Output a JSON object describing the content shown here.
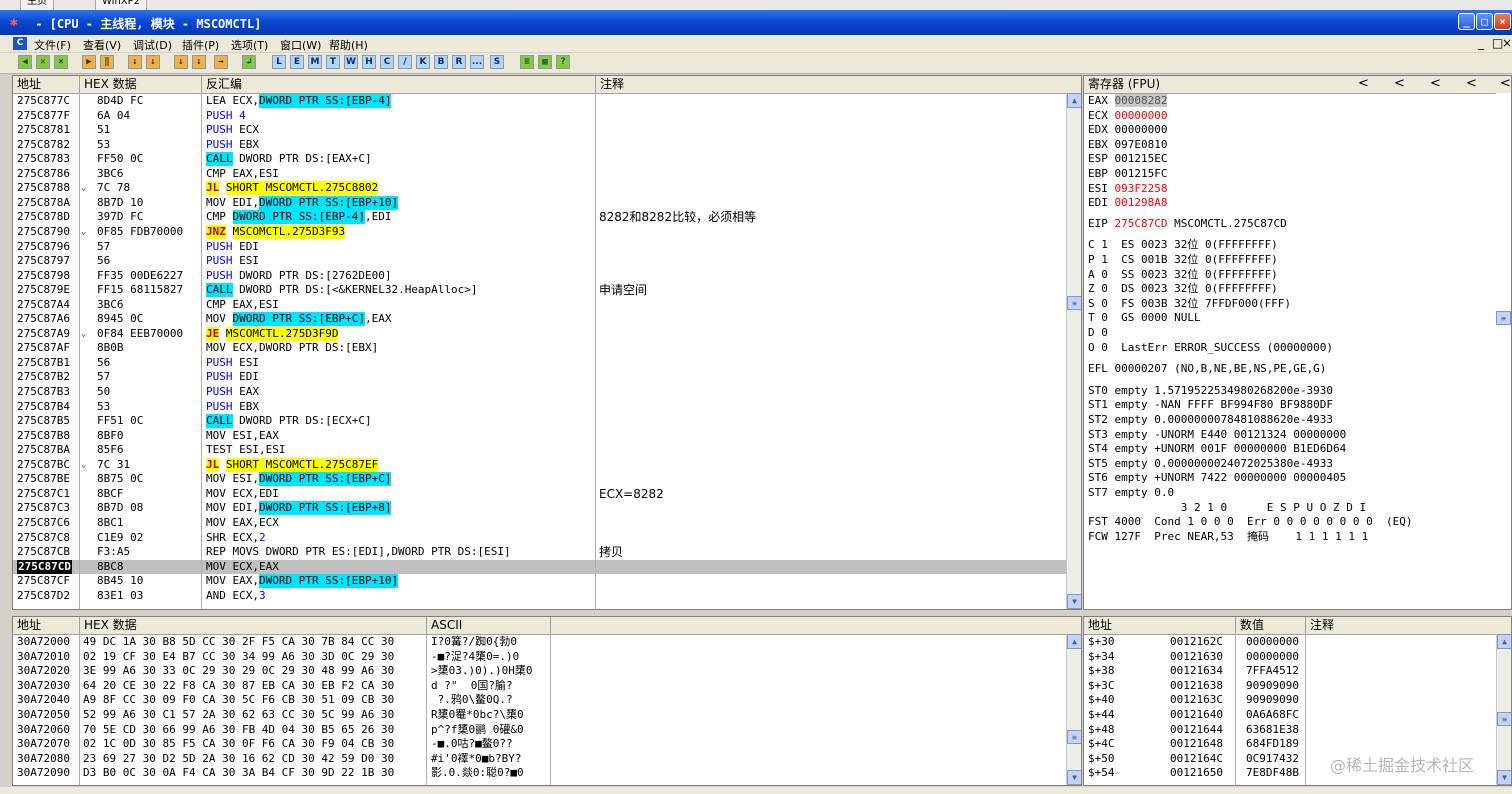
{
  "top_tabs": [
    "主页",
    "WinXP2"
  ],
  "window": {
    "title": " - [CPU - 主线程, 模块 - MSCOMCTL]",
    "btn_min": "_",
    "btn_max": "□",
    "btn_close": "×"
  },
  "menu": {
    "icon": "C",
    "items": [
      "文件(F)",
      "查看(V)",
      "调试(D)",
      "插件(P)",
      "选项(T)",
      "窗口(W)",
      "帮助(H)"
    ],
    "mdi": [
      "_",
      "□",
      "×"
    ]
  },
  "toolbar": {
    "buttons": [
      "◀",
      "✕",
      "×",
      "▶",
      "‖",
      "↓",
      "↓",
      "↓",
      "↓",
      "→",
      "↲"
    ],
    "letters": [
      "L",
      "E",
      "M",
      "T",
      "W",
      "H",
      "C",
      "/",
      "K",
      "B",
      "R",
      "...",
      "S"
    ],
    "tail": [
      "≡",
      "▦",
      "?"
    ]
  },
  "cpu": {
    "headers": [
      "地址",
      "HEX 数据",
      "反汇编",
      "注释"
    ],
    "rows": [
      {
        "addr": "275C877C",
        "mark": "",
        "hex": "8D4D FC",
        "mn": "LEA",
        "ops": [
          {
            "t": "ECX,"
          },
          {
            "t": "DWORD PTR SS:[EBP-4]",
            "c": "memop"
          }
        ],
        "com": "",
        "sel": false
      },
      {
        "addr": "275C877F",
        "mark": "",
        "hex": "6A 04",
        "mn": "PUSH",
        "mncls": "blue",
        "ops": [
          {
            "t": "4",
            "c": "blue"
          }
        ],
        "com": "",
        "sel": false
      },
      {
        "addr": "275C8781",
        "mark": "",
        "hex": "51",
        "mn": "PUSH",
        "mncls": "blue",
        "ops": [
          {
            "t": "ECX"
          }
        ],
        "com": "",
        "sel": false
      },
      {
        "addr": "275C8782",
        "mark": "",
        "hex": "53",
        "mn": "PUSH",
        "mncls": "blue",
        "ops": [
          {
            "t": "EBX"
          }
        ],
        "com": "",
        "sel": false
      },
      {
        "addr": "275C8783",
        "mark": "",
        "hex": "FF50 0C",
        "mn": "CALL",
        "mncls": "callbg",
        "ops": [
          {
            "t": "DWORD PTR DS:[EAX+C]"
          }
        ],
        "com": "",
        "sel": false
      },
      {
        "addr": "275C8786",
        "mark": "",
        "hex": "3BC6",
        "mn": "CMP",
        "ops": [
          {
            "t": "EAX,ESI"
          }
        ],
        "com": "",
        "sel": false
      },
      {
        "addr": "275C8788",
        "mark": "⌄",
        "hex": "7C 78",
        "mn": "JL",
        "mncls": "jmpbg",
        "ops": [
          {
            "t": "SHORT MSCOMCTL.275C8802",
            "c": "jtarget"
          }
        ],
        "com": "",
        "sel": false
      },
      {
        "addr": "275C878A",
        "mark": "",
        "hex": "8B7D 10",
        "mn": "MOV",
        "ops": [
          {
            "t": "EDI,"
          },
          {
            "t": "DWORD PTR SS:[EBP+10]",
            "c": "memop"
          }
        ],
        "com": "",
        "sel": false
      },
      {
        "addr": "275C878D",
        "mark": "",
        "hex": "397D FC",
        "mn": "CMP",
        "ops": [
          {
            "t": "DWORD PTR SS:[EBP-4]",
            "c": "memop"
          },
          {
            "t": ",EDI"
          }
        ],
        "com": "8282和8282比较，必须相等",
        "sel": false
      },
      {
        "addr": "275C8790",
        "mark": "⌄",
        "hex": "0F85 FDB70000",
        "mn": "JNZ",
        "mncls": "jmpbg",
        "ops": [
          {
            "t": "MSCOMCTL.275D3F93",
            "c": "jtarget"
          }
        ],
        "com": "",
        "sel": false
      },
      {
        "addr": "275C8796",
        "mark": "",
        "hex": "57",
        "mn": "PUSH",
        "mncls": "blue",
        "ops": [
          {
            "t": "EDI"
          }
        ],
        "com": "",
        "sel": false
      },
      {
        "addr": "275C8797",
        "mark": "",
        "hex": "56",
        "mn": "PUSH",
        "mncls": "blue",
        "ops": [
          {
            "t": "ESI"
          }
        ],
        "com": "",
        "sel": false
      },
      {
        "addr": "275C8798",
        "mark": "",
        "hex": "FF35 00DE6227",
        "mn": "PUSH",
        "mncls": "blue",
        "ops": [
          {
            "t": "DWORD PTR DS:[2762DE00]"
          }
        ],
        "com": "",
        "sel": false
      },
      {
        "addr": "275C879E",
        "mark": "",
        "hex": "FF15 68115827",
        "mn": "CALL",
        "mncls": "callbg",
        "ops": [
          {
            "t": "DWORD PTR DS:[<&KERNEL32.HeapAlloc>]"
          }
        ],
        "com": "申请空间",
        "sel": false
      },
      {
        "addr": "275C87A4",
        "mark": "",
        "hex": "3BC6",
        "mn": "CMP",
        "ops": [
          {
            "t": "EAX,ESI"
          }
        ],
        "com": "",
        "sel": false
      },
      {
        "addr": "275C87A6",
        "mark": "",
        "hex": "8945 0C",
        "mn": "MOV",
        "ops": [
          {
            "t": "DWORD PTR SS:[EBP+C]",
            "c": "memop"
          },
          {
            "t": ",EAX"
          }
        ],
        "com": "",
        "sel": false
      },
      {
        "addr": "275C87A9",
        "mark": "⌄",
        "hex": "0F84 EEB70000",
        "mn": "JE",
        "mncls": "jmpbg",
        "ops": [
          {
            "t": "MSCOMCTL.275D3F9D",
            "c": "jtarget"
          }
        ],
        "com": "",
        "sel": false
      },
      {
        "addr": "275C87AF",
        "mark": "",
        "hex": "8B0B",
        "mn": "MOV",
        "ops": [
          {
            "t": "ECX,DWORD PTR DS:[EBX]"
          }
        ],
        "com": "",
        "sel": false
      },
      {
        "addr": "275C87B1",
        "mark": "",
        "hex": "56",
        "mn": "PUSH",
        "mncls": "blue",
        "ops": [
          {
            "t": "ESI"
          }
        ],
        "com": "",
        "sel": false
      },
      {
        "addr": "275C87B2",
        "mark": "",
        "hex": "57",
        "mn": "PUSH",
        "mncls": "blue",
        "ops": [
          {
            "t": "EDI"
          }
        ],
        "com": "",
        "sel": false
      },
      {
        "addr": "275C87B3",
        "mark": "",
        "hex": "50",
        "mn": "PUSH",
        "mncls": "blue",
        "ops": [
          {
            "t": "EAX"
          }
        ],
        "com": "",
        "sel": false
      },
      {
        "addr": "275C87B4",
        "mark": "",
        "hex": "53",
        "mn": "PUSH",
        "mncls": "blue",
        "ops": [
          {
            "t": "EBX"
          }
        ],
        "com": "",
        "sel": false
      },
      {
        "addr": "275C87B5",
        "mark": "",
        "hex": "FF51 0C",
        "mn": "CALL",
        "mncls": "callbg",
        "ops": [
          {
            "t": "DWORD PTR DS:[ECX+C]"
          }
        ],
        "com": "",
        "sel": false
      },
      {
        "addr": "275C87B8",
        "mark": "",
        "hex": "8BF0",
        "mn": "MOV",
        "ops": [
          {
            "t": "ESI,EAX"
          }
        ],
        "com": "",
        "sel": false
      },
      {
        "addr": "275C87BA",
        "mark": "",
        "hex": "85F6",
        "mn": "TEST",
        "ops": [
          {
            "t": "ESI,ESI"
          }
        ],
        "com": "",
        "sel": false
      },
      {
        "addr": "275C87BC",
        "mark": "⌄",
        "hex": "7C 31",
        "mn": "JL",
        "mncls": "jmpbg",
        "ops": [
          {
            "t": "SHORT MSCOMCTL.275C87EF",
            "c": "jtarget"
          }
        ],
        "com": "",
        "sel": false
      },
      {
        "addr": "275C87BE",
        "mark": "",
        "hex": "8B75 0C",
        "mn": "MOV",
        "ops": [
          {
            "t": "ESI,"
          },
          {
            "t": "DWORD PTR SS:[EBP+C]",
            "c": "memop"
          }
        ],
        "com": "",
        "sel": false
      },
      {
        "addr": "275C87C1",
        "mark": "",
        "hex": "8BCF",
        "mn": "MOV",
        "ops": [
          {
            "t": "ECX,EDI"
          }
        ],
        "com": "ECX=8282",
        "sel": false
      },
      {
        "addr": "275C87C3",
        "mark": "",
        "hex": "8B7D 08",
        "mn": "MOV",
        "ops": [
          {
            "t": "EDI,"
          },
          {
            "t": "DWORD PTR SS:[EBP+8]",
            "c": "memop"
          }
        ],
        "com": "",
        "sel": false
      },
      {
        "addr": "275C87C6",
        "mark": "",
        "hex": "8BC1",
        "mn": "MOV",
        "ops": [
          {
            "t": "EAX,ECX"
          }
        ],
        "com": "",
        "sel": false
      },
      {
        "addr": "275C87C8",
        "mark": "",
        "hex": "C1E9 02",
        "mn": "SHR",
        "ops": [
          {
            "t": "ECX,"
          },
          {
            "t": "2",
            "c": "blue"
          }
        ],
        "com": "",
        "sel": false
      },
      {
        "addr": "275C87CB",
        "mark": "",
        "hex": "F3:A5",
        "mn": "REP MOVS",
        "ops": [
          {
            "t": "DWORD PTR ES:[EDI],DWORD PTR DS:[ESI]"
          }
        ],
        "com": "拷贝",
        "sel": false
      },
      {
        "addr": "275C87CD",
        "mark": "",
        "hex": "8BC8",
        "mn": "MOV",
        "ops": [
          {
            "t": "ECX,EAX"
          }
        ],
        "com": "",
        "sel": true
      },
      {
        "addr": "275C87CF",
        "mark": "",
        "hex": "8B45 10",
        "mn": "MOV",
        "ops": [
          {
            "t": "EAX,"
          },
          {
            "t": "DWORD PTR SS:[EBP+10]",
            "c": "memop"
          }
        ],
        "com": "",
        "sel": false
      },
      {
        "addr": "275C87D2",
        "mark": "",
        "hex": "83E1 03",
        "mn": "AND",
        "ops": [
          {
            "t": "ECX,"
          },
          {
            "t": "3",
            "c": "blue"
          }
        ],
        "com": "",
        "sel": false
      }
    ]
  },
  "registers": {
    "title": "寄存器 (FPU)",
    "nav": [
      "<",
      "<",
      "<",
      "<",
      "<"
    ],
    "gp": [
      {
        "name": "EAX",
        "val": "00008282",
        "style": "grayhl",
        "extra": ""
      },
      {
        "name": "ECX",
        "val": "00000000",
        "style": "red",
        "extra": ""
      },
      {
        "name": "EDX",
        "val": "00000000",
        "style": "",
        "extra": ""
      },
      {
        "name": "EBX",
        "val": "097E0810",
        "style": "",
        "extra": ""
      },
      {
        "name": "ESP",
        "val": "001215EC",
        "style": "",
        "extra": ""
      },
      {
        "name": "EBP",
        "val": "001215FC",
        "style": "",
        "extra": ""
      },
      {
        "name": "ESI",
        "val": "093F2258",
        "style": "red",
        "extra": ""
      },
      {
        "name": "EDI",
        "val": "001298A8",
        "style": "red",
        "extra": ""
      }
    ],
    "eip": {
      "name": "EIP",
      "val": "275C87CD",
      "extra": "MSCOMCTL.275C87CD"
    },
    "seg": [
      "C 1  ES 0023 32位 0(FFFFFFFF)",
      "P 1  CS 001B 32位 0(FFFFFFFF)",
      "A 0  SS 0023 32位 0(FFFFFFFF)",
      "Z 0  DS 0023 32位 0(FFFFFFFF)",
      "S 0  FS 003B 32位 7FFDF000(FFF)",
      "T 0  GS 0000 NULL",
      "D 0",
      "O 0  LastErr ERROR_SUCCESS (00000000)"
    ],
    "efl": "EFL 00000207 (NO,B,NE,BE,NS,PE,GE,G)",
    "st": [
      "ST0 empty 1.5719522534980268200e-3930",
      "ST1 empty -NAN FFFF BF994F80 BF9880DF",
      "ST2 empty 0.0000000078481088620e-4933",
      "ST3 empty -UNORM E440 00121324 00000000",
      "ST4 empty +UNORM 001F 00000000 B1ED6D64",
      "ST5 empty 0.0000000024072025380e-4933",
      "ST6 empty +UNORM 7422 00000000 00000405",
      "ST7 empty 0.0"
    ],
    "fpu_hdr": "              3 2 1 0      E S P U O Z D I",
    "fst": "FST 4000  Cond 1 0 0 0  Err 0 0 0 0 0 0 0 0  (EQ)",
    "fcw": "FCW 127F  Prec NEAR,53  掩码    1 1 1 1 1 1"
  },
  "dump": {
    "headers": [
      "地址",
      "HEX 数据",
      "ASCII"
    ],
    "rows": [
      {
        "addr": "30A72000",
        "hex": "49 DC 1A 30 B8 5D CC 30 2F F5 CA 30 7B 84 CC 30",
        "ascii": "I?0篝?/踟0{勃0"
      },
      {
        "addr": "30A72010",
        "hex": "02 19 CF 30 E4 B7 CC 30 34 99 A6 30 3D 0C 29 30",
        "ascii": "-■?浞?4橥0=.)0"
      },
      {
        "addr": "30A72020",
        "hex": "3E 99 A6 30 33 0C 29 30 29 0C 29 30 48 99 A6 30",
        "ascii": ">橥03.)0).)0H橥0"
      },
      {
        "addr": "30A72030",
        "hex": "64 20 CE 30 22 F8 CA 30 87 EB CA 30 EB F2 CA 30",
        "ascii": "d ?\"  0国?腧?"
      },
      {
        "addr": "30A72040",
        "hex": "A9 8F CC 30 09 F0 CA 30 5C F6 CB 30 51 09 CB 30",
        "ascii": " ?.鸦0\\鳌0Q.?"
      },
      {
        "addr": "30A72050",
        "hex": "52 99 A6 30 C1 57 2A 30 62 63 CC 30 5C 99 A6 30",
        "ascii": "R橥0罨*0bc?\\橥0"
      },
      {
        "addr": "30A72060",
        "hex": "70 5E CD 30 66 99 A6 30 FB 4D 04 30 B5 65 26 30",
        "ascii": "p^?f橥0鹂 0礶&0"
      },
      {
        "addr": "30A72070",
        "hex": "02 1C 0D 30 85 F5 CA 30 0F F6 CA 30 F9 04 CB 30",
        "ascii": "-■.0咕?■鳌0??"
      },
      {
        "addr": "30A72080",
        "hex": "23 69 27 30 D2 5D 2A 30 16 62 CD 30 42 59 D0 30",
        "ascii": "#i'0襗*0■b?BY?"
      },
      {
        "addr": "30A72090",
        "hex": "D3 B0 0C 30 0A F4 CA 30 3A B4 CF 30 9D 22 1B 30",
        "ascii": "影.0.燚0:聪0?■0"
      }
    ]
  },
  "stack": {
    "headers": [
      "地址",
      "数值",
      "注释"
    ],
    "rows": [
      {
        "off": "$+30",
        "addr": "0012162C",
        "val": "00000000"
      },
      {
        "off": "$+34",
        "addr": "00121630",
        "val": "00000000"
      },
      {
        "off": "$+38",
        "addr": "00121634",
        "val": "7FFA4512"
      },
      {
        "off": "$+3C",
        "addr": "00121638",
        "val": "90909090"
      },
      {
        "off": "$+40",
        "addr": "0012163C",
        "val": "90909090"
      },
      {
        "off": "$+44",
        "addr": "00121640",
        "val": "0A6A68FC"
      },
      {
        "off": "$+48",
        "addr": "00121644",
        "val": "63681E38"
      },
      {
        "off": "$+4C",
        "addr": "00121648",
        "val": "684FD189"
      },
      {
        "off": "$+50",
        "addr": "0012164C",
        "val": "0C917432"
      },
      {
        "off": "$+54",
        "addr": "00121650",
        "val": "7E8DF48B"
      }
    ]
  },
  "watermark": "@稀土掘金技术社区"
}
